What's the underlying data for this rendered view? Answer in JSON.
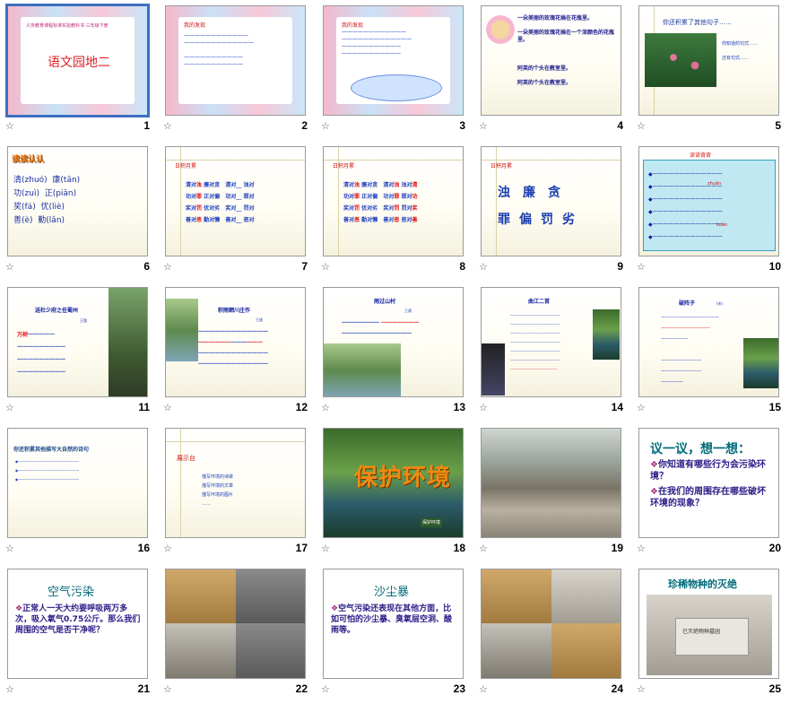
{
  "slides": [
    {
      "num": "1",
      "title": "语文园地二",
      "subtitle": "义务教育课程标准实验教科书 三年级下册"
    },
    {
      "num": "2",
      "heading": "我的发现"
    },
    {
      "num": "3",
      "heading": "我的发现"
    },
    {
      "num": "4",
      "lines": [
        "一朵美丽的玫瑰花插在花瓶里。",
        "一朵美丽的玫瑰花插在一个深颜色的花瓶里。",
        "阿英的个头在教室里。",
        "阿英的个头在教室里。"
      ]
    },
    {
      "num": "5",
      "heading": "你还积累了其他句子……",
      "side": [
        "你知道的句式……",
        "还有句式……"
      ]
    },
    {
      "num": "6",
      "heading": "读读认认",
      "pairs": [
        [
          "清(zhuó)",
          "康(tān)"
        ],
        [
          "功(zuì)",
          "正(piān)"
        ],
        [
          "奖(fá)",
          "优(liè)"
        ],
        [
          "善(è)",
          "勤(lǎn)"
        ]
      ]
    },
    {
      "num": "7",
      "heading": "日积月累"
    },
    {
      "num": "8",
      "heading": "日积月累"
    },
    {
      "num": "9",
      "heading": "日积月累",
      "row1": [
        "浊",
        "廉",
        "贪"
      ],
      "row2": [
        "罪",
        "偏",
        "罚",
        "劣"
      ]
    },
    {
      "num": "10",
      "heading": "读读背背",
      "tags": [
        "zhuān",
        "kuān"
      ]
    },
    {
      "num": "11",
      "heading": "送杜少府之任蜀州",
      "author": "王勃"
    },
    {
      "num": "12",
      "heading": "积雨辋川庄作",
      "author": "王维"
    },
    {
      "num": "13",
      "heading": "雨过山村",
      "author": "王建"
    },
    {
      "num": "14",
      "heading": "曲江二首"
    },
    {
      "num": "15",
      "heading": "破阵子",
      "author": "(宋)"
    },
    {
      "num": "16",
      "heading": "你还积累其他描写大自然的诗句"
    },
    {
      "num": "17",
      "heading": "展示台",
      "items": [
        "描写环境的诗歌",
        "描写环境的文章",
        "描写环境的图片",
        "……"
      ]
    },
    {
      "num": "18",
      "headline": "保护环境",
      "tag": "保护环境"
    },
    {
      "num": "19"
    },
    {
      "num": "20",
      "title": "议一议，想一想：",
      "bullets": [
        "你知道有哪些行为会污染环境？",
        "在我们的周围存在哪些破坏环境的现象？"
      ]
    },
    {
      "num": "21",
      "title": "空气污染",
      "body": "正常人一天大约要呼吸两万多次，吸入氧气0.75公斤。那么我们周围的空气是否干净呢？"
    },
    {
      "num": "22"
    },
    {
      "num": "23",
      "title": "沙尘暴",
      "body": "空气污染还表现在其他方面，比如可怕的沙尘暴、臭氧层空洞、酸雨等。"
    },
    {
      "num": "24"
    },
    {
      "num": "25",
      "title": "珍稀物种的灭绝",
      "plaque": "已灭绝物种墓园"
    }
  ],
  "star_glyph": "☆"
}
